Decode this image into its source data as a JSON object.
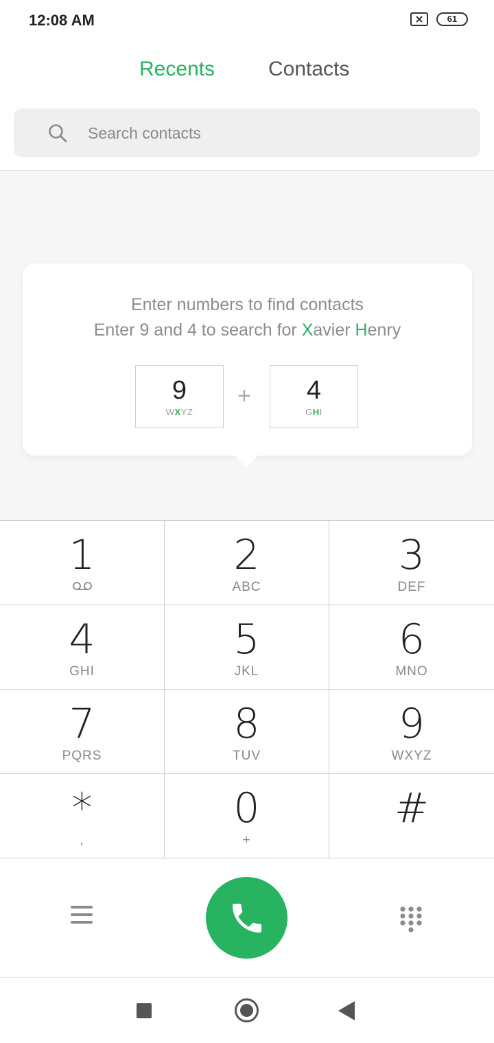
{
  "status_bar": {
    "time": "12:08 AM",
    "battery": "61",
    "icons": [
      "no-sim-icon",
      "battery-icon"
    ]
  },
  "tabs": [
    {
      "label": "Recents",
      "active": true
    },
    {
      "label": "Contacts",
      "active": false
    }
  ],
  "search": {
    "placeholder": "Search contacts",
    "value": ""
  },
  "hint": {
    "line1": "Enter numbers to find contacts",
    "line2_prefix": "Enter 9 and 4 to search for ",
    "name_first_initial": "X",
    "name_first_rest": "avier",
    "name_last_initial": "H",
    "name_last_rest": "enry",
    "key1": {
      "digit": "9",
      "letters_pre": "W",
      "letters_hl": "X",
      "letters_post": "YZ"
    },
    "plus": "+",
    "key2": {
      "digit": "4",
      "letters_pre": "G",
      "letters_hl": "H",
      "letters_post": "I"
    }
  },
  "dialpad": {
    "keys": [
      {
        "digit": "1",
        "sub": "",
        "icon": "voicemail-icon"
      },
      {
        "digit": "2",
        "sub": "ABC"
      },
      {
        "digit": "3",
        "sub": "DEF"
      },
      {
        "digit": "4",
        "sub": "GHI"
      },
      {
        "digit": "5",
        "sub": "JKL"
      },
      {
        "digit": "6",
        "sub": "MNO"
      },
      {
        "digit": "7",
        "sub": "PQRS"
      },
      {
        "digit": "8",
        "sub": "TUV"
      },
      {
        "digit": "9",
        "sub": "WXYZ"
      },
      {
        "digit": "*",
        "sub": ","
      },
      {
        "digit": "0",
        "sub": "+"
      },
      {
        "digit": "#",
        "sub": ""
      }
    ]
  },
  "actions": {
    "left_icon": "menu-icon",
    "center_icon": "phone-icon",
    "right_icon": "dialpad-icon"
  },
  "colors": {
    "accent": "#27b35f",
    "background_gray": "#f6f6f6"
  }
}
